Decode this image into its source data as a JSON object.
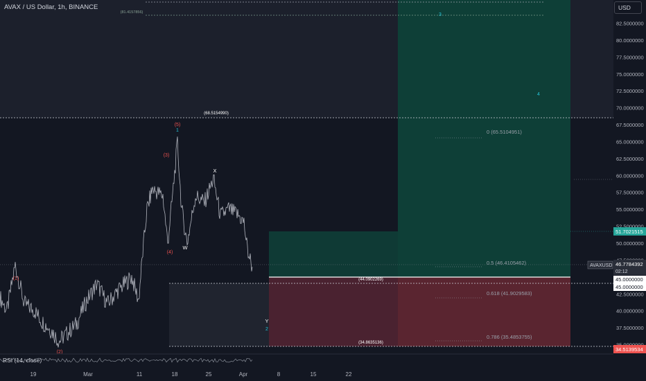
{
  "header": {
    "title": "AVAX / US Dollar, 1h, BINANCE",
    "currency_button": "USD",
    "indicator": "RSI (14, close)"
  },
  "colors": {
    "background": "#131722",
    "candles": "#b2b5be",
    "target_zone": "#0b3d36",
    "upper_zone": "#0d4a40",
    "stop_zone": "#5a2530",
    "grey_zone": "#2a2e39",
    "price_tag": "#26a69a",
    "stop_tag": "#ef5350",
    "wave_red": "#ef5350",
    "wave_teal": "#26a69a"
  },
  "chart_data": {
    "type": "candlestick",
    "symbol": "AVAXUSD",
    "last_price": "46.7784392",
    "countdown": "02:12",
    "y_axis": {
      "range": [
        34.0,
        85.0
      ],
      "ticks": [
        "35.0000000",
        "37.5000000",
        "40.0000000",
        "42.5000000",
        "45.0000000",
        "47.5000000",
        "50.0000000",
        "52.5000000",
        "55.0000000",
        "57.5000000",
        "60.0000000",
        "62.5000000",
        "65.0000000",
        "67.5000000",
        "70.0000000",
        "72.5000000",
        "75.0000000",
        "77.5000000",
        "80.0000000",
        "82.5000000"
      ]
    },
    "x_axis": {
      "ticks": [
        "19",
        "Mar",
        "11",
        "18",
        "25",
        "Apr",
        "8",
        "15",
        "22"
      ]
    },
    "price_tags": [
      {
        "label": "51.7021515",
        "value": 51.7021515,
        "kind": "target"
      },
      {
        "label": "45.0000000",
        "value": 45.0,
        "kind": "entry"
      },
      {
        "label": "45.0000000",
        "value": 45.0,
        "kind": "entry"
      },
      {
        "label": "34.5139534",
        "value": 34.5139534,
        "kind": "stop"
      }
    ],
    "levels": [
      {
        "label": "(68.5154990)",
        "value": 68.515499
      },
      {
        "label": "(44.0902269)",
        "value": 44.0902269
      },
      {
        "label": "(34.8635136)",
        "value": 34.8635136
      },
      {
        "label": "(81.4157856)",
        "value": 81.4157856
      }
    ],
    "fib_levels": [
      {
        "label": "0 (65.5104951)",
        "value": 65.5104951
      },
      {
        "label": "0.5 (46.4105462)",
        "value": 46.4105462
      },
      {
        "label": "0.618 (41.9029583)",
        "value": 41.9029583
      },
      {
        "label": "0.786 (35.4853755)",
        "value": 35.4853755
      }
    ],
    "wave_labels": [
      {
        "text": "(1)",
        "date": "Feb 23",
        "value": 47.8,
        "color": "red"
      },
      {
        "text": "(2)",
        "date": "Feb 26",
        "value": 35.2,
        "color": "red"
      },
      {
        "text": "(3)",
        "date": "Mar 16",
        "value": 61.9,
        "color": "red"
      },
      {
        "text": "(4)",
        "date": "Mar 14",
        "value": 48.9,
        "color": "red"
      },
      {
        "text": "(5)",
        "date": "Mar 18",
        "value": 66.9,
        "color": "red"
      },
      {
        "text": "1",
        "date": "Mar 18",
        "value": 65.8,
        "color": "teal"
      },
      {
        "text": "W",
        "date": "Mar 19",
        "value": 49.6,
        "color": "white"
      },
      {
        "text": "X",
        "date": "Mar 26",
        "value": 60.4,
        "color": "white"
      },
      {
        "text": "Y",
        "date": "Apr 5",
        "value": 38.6,
        "color": "white"
      },
      {
        "text": "2",
        "date": "Apr 5",
        "value": 37.4,
        "color": "teal"
      },
      {
        "text": "3",
        "date": "May 15",
        "value": 83.8,
        "color": "teal"
      },
      {
        "text": "4",
        "date": "Jun 5",
        "value": 71.8,
        "color": "teal"
      }
    ]
  }
}
